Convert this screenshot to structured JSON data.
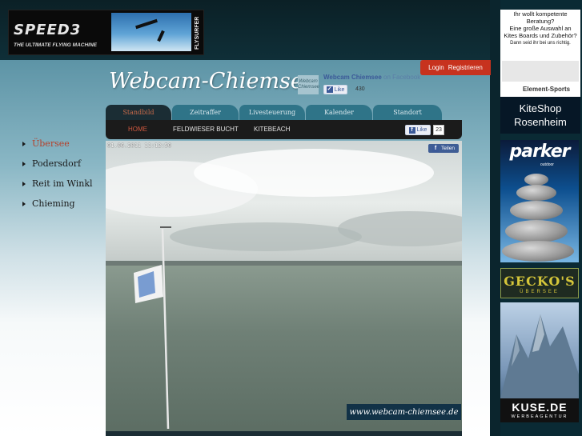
{
  "banner": {
    "brand": "SPEED3",
    "tagline": "THE ULTIMATE FLYING MACHINE",
    "side_logo": "FLYSURFER"
  },
  "header": {
    "login": "Login",
    "register": "Registrieren",
    "site_title": "Webcam-Chiemsee"
  },
  "fb_widget": {
    "thumb_text": "Webcam Chiemsee",
    "page_name": "Webcam Chiemsee",
    "on_facebook": "on Facebook",
    "like_label": "Like",
    "like_count": "430"
  },
  "tabs": [
    {
      "label": "Standbild",
      "active": true
    },
    {
      "label": "Zeitraffer",
      "active": false
    },
    {
      "label": "Livesteuerung",
      "active": false
    },
    {
      "label": "Kalender",
      "active": false
    },
    {
      "label": "Standort",
      "active": false
    }
  ],
  "subnav": {
    "links": [
      {
        "label": "HOME",
        "active": true
      },
      {
        "label": "FELDWIESER BUCHT",
        "active": false
      },
      {
        "label": "KITEBEACH",
        "active": false
      }
    ],
    "like_label": "Like",
    "like_count": "23"
  },
  "sidebar": {
    "items": [
      {
        "label": "Übersee",
        "active": true
      },
      {
        "label": "Podersdorf",
        "active": false
      },
      {
        "label": "Reit im Winkl",
        "active": false
      },
      {
        "label": "Chieming",
        "active": false
      }
    ]
  },
  "webcam": {
    "timestamp": "01.06.2011 11:12:50",
    "share_label": "Teilen",
    "watermark": "www.webcam-chiemsee.de"
  },
  "ads": {
    "ad1": {
      "lines": [
        "Ihr wollt kompetente Beratung?",
        "Eine große Auswahl an",
        "Kites Boards und Zubehör?"
      ],
      "small": "Dann seid ihr bei uns richtig.",
      "logo_text": "Element-Sports",
      "shop_line1": "KiteShop",
      "shop_line2": "Rosenheim"
    },
    "ad2": {
      "brand": "parker",
      "sub": "outdoor"
    },
    "ad3": {
      "brand": "GECKO'S",
      "sub": "ÜBERSEE"
    },
    "ad4": {
      "brand": "KUSE.DE",
      "sub": "WERBEAGENTUR"
    }
  },
  "colors": {
    "accent_red": "#c7321e",
    "tab_active_text": "#c96a49",
    "tab_bg": "#2f7488",
    "subnav_bg": "#1b1b1b",
    "fb_blue": "#3b5998"
  }
}
